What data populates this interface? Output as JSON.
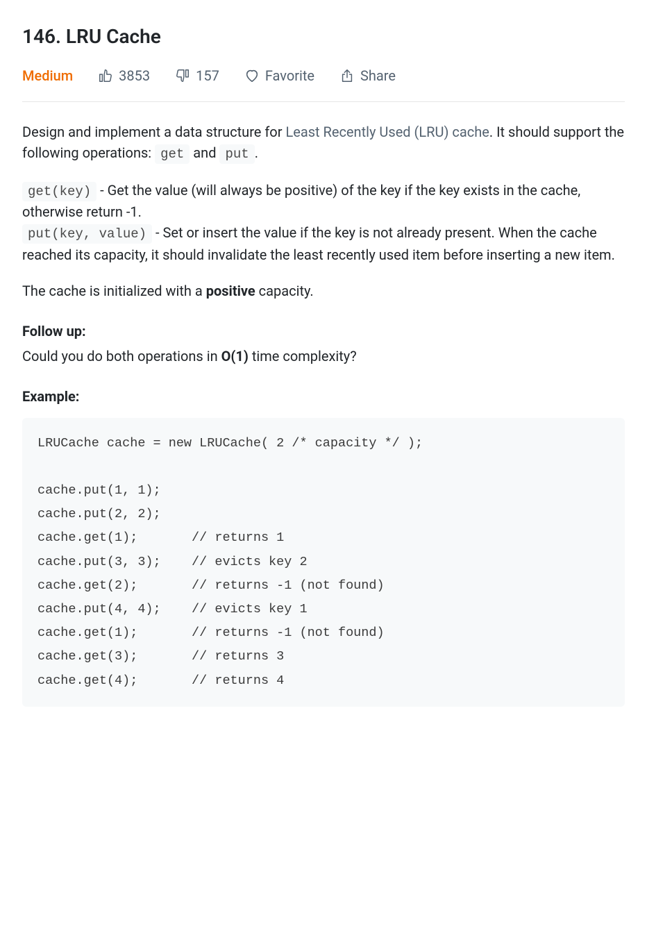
{
  "title": "146. LRU Cache",
  "meta": {
    "difficulty": "Medium",
    "likes": "3853",
    "dislikes": "157",
    "favorite": "Favorite",
    "share": "Share"
  },
  "content": {
    "intro_prefix": "Design and implement a data structure for ",
    "intro_link": "Least Recently Used (LRU) cache",
    "intro_mid": ". It should support the following operations: ",
    "code_get": "get",
    "intro_and": " and ",
    "code_put": "put",
    "intro_suffix": ".",
    "get_sig": "get(key)",
    "get_desc": " - Get the value (will always be positive) of the key if the key exists in the cache, otherwise return -1.",
    "put_sig": "put(key, value)",
    "put_desc": " - Set or insert the value if the key is not already present. When the cache reached its capacity, it should invalidate the least recently used item before inserting a new item.",
    "cap_prefix": "The cache is initialized with a ",
    "cap_bold": "positive",
    "cap_suffix": " capacity.",
    "followup_label": "Follow up:",
    "followup_prefix": "Could you do both operations in ",
    "followup_bold": "O(1)",
    "followup_suffix": " time complexity?",
    "example_label": "Example:",
    "code_example": "LRUCache cache = new LRUCache( 2 /* capacity */ );\n\ncache.put(1, 1);\ncache.put(2, 2);\ncache.get(1);       // returns 1\ncache.put(3, 3);    // evicts key 2\ncache.get(2);       // returns -1 (not found)\ncache.put(4, 4);    // evicts key 1\ncache.get(1);       // returns -1 (not found)\ncache.get(3);       // returns 3\ncache.get(4);       // returns 4"
  }
}
